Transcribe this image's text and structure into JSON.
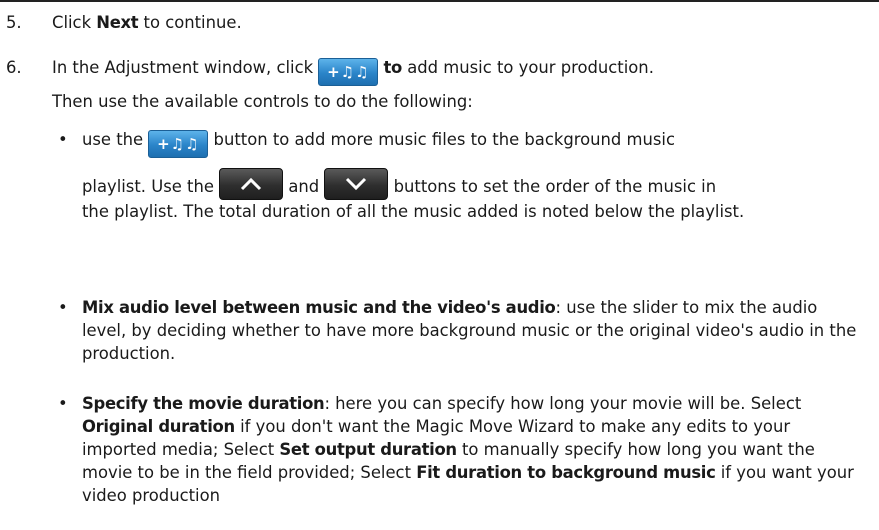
{
  "step5": {
    "number": "5.",
    "pre": "Click ",
    "bold": "Next",
    "post": " to continue."
  },
  "step6": {
    "number": "6.",
    "line1_pre": "In the Adjustment window, click ",
    "line1_bold": "to",
    "line1_post": " add music to your production.",
    "line2": "Then use the available controls to do the following:"
  },
  "music_button": {
    "glyph": "+♫♫",
    "icon": "add-music-icon"
  },
  "bullets": [
    {
      "marker": "•",
      "l1_pre": "use the ",
      "l1_post": " button to add more music files to the background music",
      "l2_pre": "playlist. Use the ",
      "l2_mid": " and ",
      "l2_post": " buttons to set the order of the music in",
      "rest": "the playlist. The total duration of all the music added is noted below the playlist."
    },
    {
      "marker": "•",
      "bold": "Mix audio level between music and the video's audio",
      "text": ": use the slider to mix the audio level, by deciding whether to have more background music or the original video's audio in the production."
    },
    {
      "marker": "•",
      "bold": "Specify the movie duration",
      "t1": ": here you can specify how long your movie will be. Select ",
      "b2": "Original duration",
      "t2": " if you don't want the Magic Move Wizard to make any edits to your imported media; Select ",
      "b3": "Set output duration",
      "t3": " to manually specify how long you want the movie to be in the field provided; Select ",
      "b4": "Fit duration to background music",
      "t4": " if you want your video production"
    }
  ],
  "up_button": {
    "icon": "chevron-up-icon"
  },
  "down_button": {
    "icon": "chevron-down-icon"
  }
}
